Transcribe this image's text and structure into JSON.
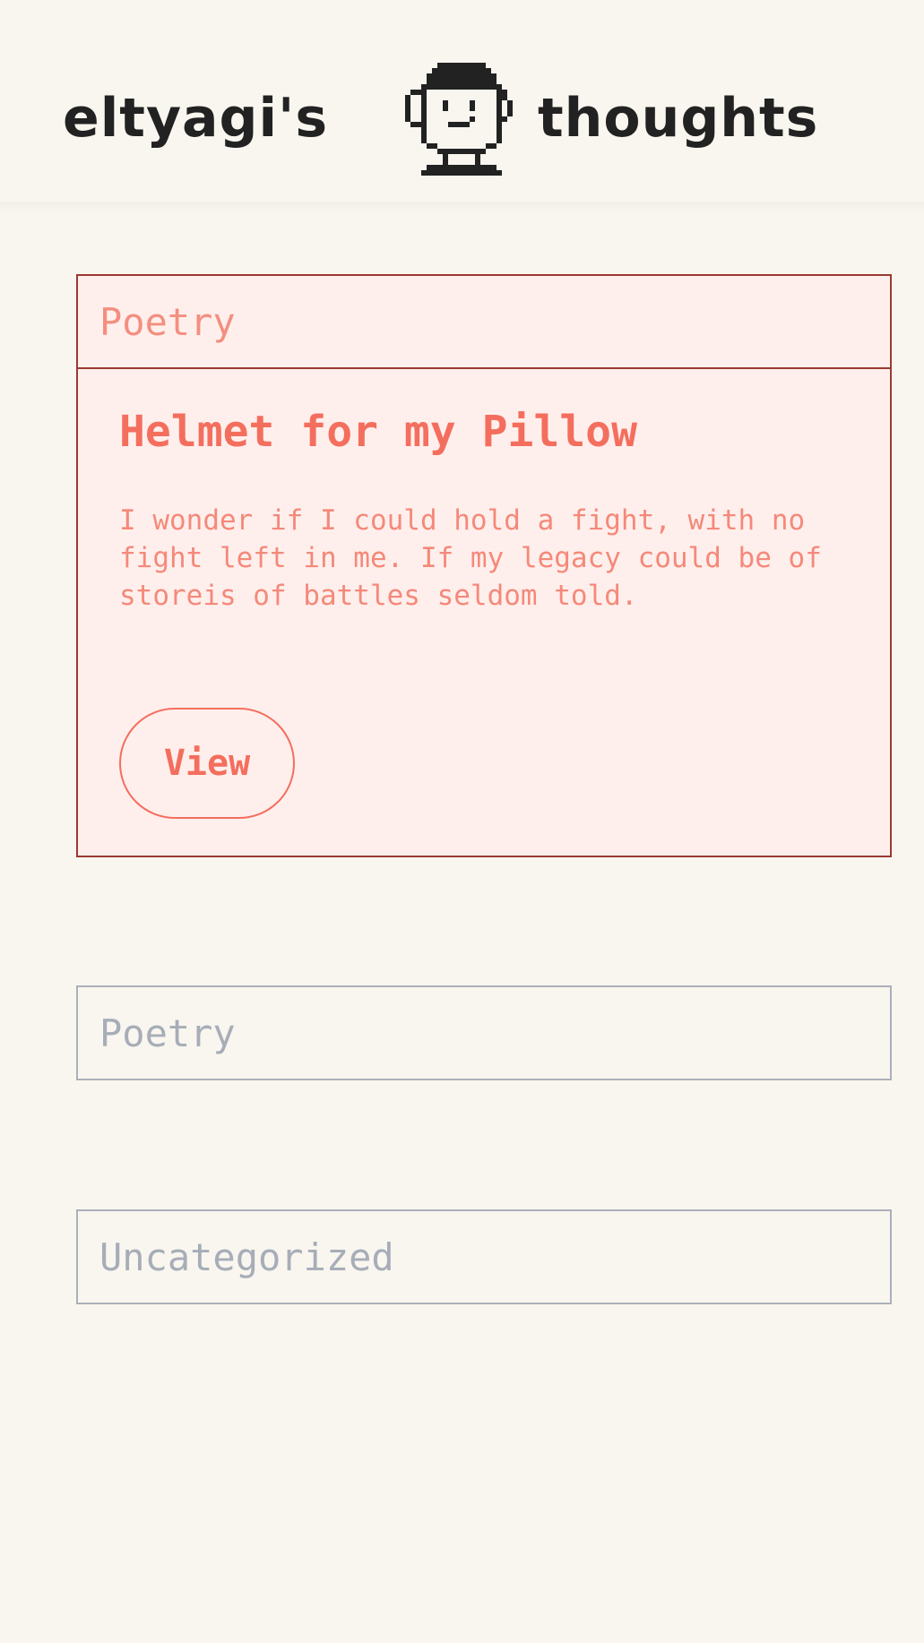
{
  "site": {
    "title_left": "eltyagi's",
    "title_right": "thoughts",
    "avatar_icon": "pixel-avatar-icon"
  },
  "featured_card": {
    "category": "Poetry",
    "title": "Helmet for my Pillow",
    "excerpt": "I wonder if I could hold a fight, with no fight left in me. If my legacy could be of storeis of battles seldom told.",
    "button_label": "View"
  },
  "categories": [
    {
      "label": "Poetry"
    },
    {
      "label": "Uncategorized"
    }
  ],
  "colors": {
    "background": "#f9f6ef",
    "accent": "#f46e5e",
    "card_border": "#9a3a32",
    "card_background": "#ffefec",
    "muted_border": "#aab0ba",
    "heading_text": "#222222"
  }
}
